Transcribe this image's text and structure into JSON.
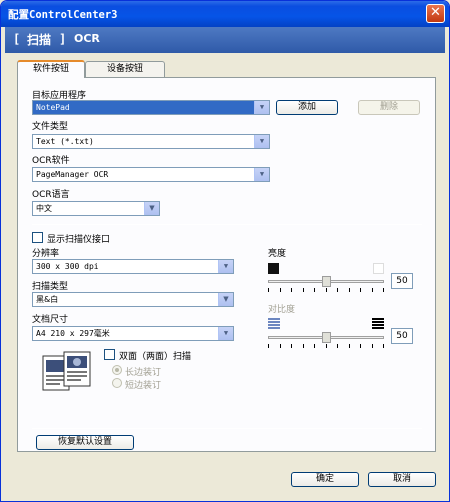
{
  "window": {
    "title": "配置ControlCenter3",
    "close_symbol": "✕"
  },
  "header": {
    "bracket_open": "[",
    "section": "扫描",
    "bracket_close": "]",
    "subsection": "OCR"
  },
  "tabs": [
    {
      "label": "软件按钮",
      "active": true
    },
    {
      "label": "设备按钮",
      "active": false
    }
  ],
  "target_app": {
    "label": "目标应用程序",
    "value": "NotePad",
    "add_label": "添加",
    "delete_label": "删除"
  },
  "file_type": {
    "label": "文件类型",
    "value": "Text (*.txt)"
  },
  "ocr_software": {
    "label": "OCR软件",
    "value": "PageManager OCR"
  },
  "ocr_language": {
    "label": "OCR语言",
    "value": "中文"
  },
  "show_scanner_ui": {
    "label": "显示扫描仪接口",
    "checked": false
  },
  "resolution": {
    "label": "分辨率",
    "value": "300 x 300 dpi"
  },
  "scan_type": {
    "label": "扫描类型",
    "value": "黑&白"
  },
  "doc_size": {
    "label": "文档尺寸",
    "value": "A4 210 x 297毫米"
  },
  "brightness": {
    "label": "亮度",
    "value": "50",
    "level": 0.5
  },
  "contrast": {
    "label": "对比度",
    "value": "50",
    "level": 0.5
  },
  "duplex": {
    "label": "双面（两面）扫描",
    "checked": false,
    "long_edge": "长边装订",
    "short_edge": "短边装订"
  },
  "restore_label": "恢复默认设置",
  "ok_label": "确定",
  "cancel_label": "取消",
  "colors": {
    "titlebar": "#0654e7",
    "header": "#3a64b0",
    "selection": "#316ac5",
    "tab_accent": "#e68b2c"
  }
}
